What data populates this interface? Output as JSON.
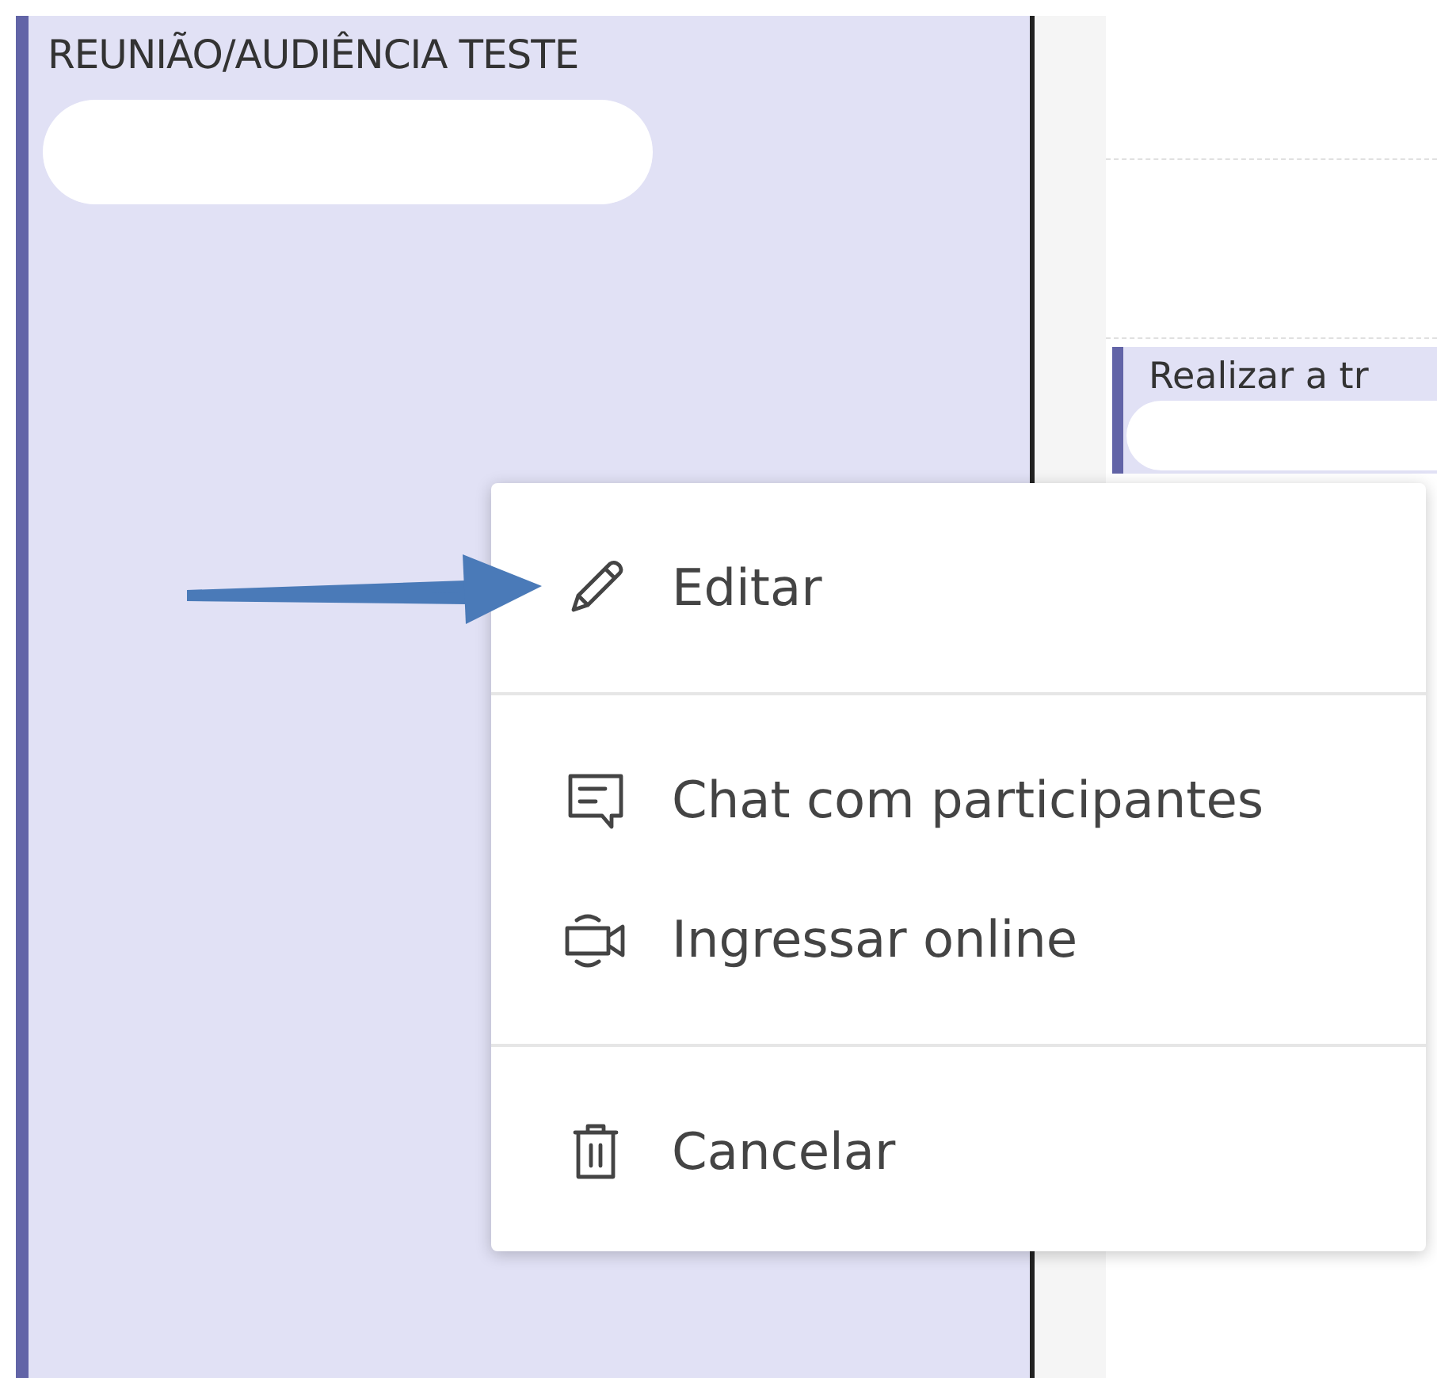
{
  "calendar": {
    "events": [
      {
        "title": "REUNIÃO/AUDIÊNCIA TESTE",
        "redacted": true
      },
      {
        "title": "Realizar a tr",
        "redacted": true
      }
    ]
  },
  "context_menu": {
    "sections": [
      {
        "items": [
          {
            "kind": "edit",
            "label": "Editar"
          }
        ]
      },
      {
        "items": [
          {
            "kind": "chat",
            "label": "Chat com participantes"
          },
          {
            "kind": "video",
            "label": "Ingressar online"
          }
        ]
      },
      {
        "items": [
          {
            "kind": "delete",
            "label": "Cancelar"
          }
        ]
      }
    ]
  },
  "annotation": {
    "kind": "arrow"
  }
}
